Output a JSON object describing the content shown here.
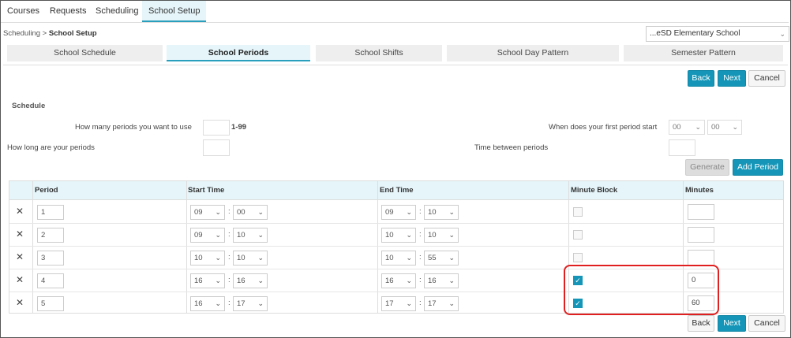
{
  "nav": [
    {
      "label": "Courses"
    },
    {
      "label": "Requests"
    },
    {
      "label": "Scheduling"
    },
    {
      "label": "School Setup",
      "active": true
    }
  ],
  "breadcrumb": {
    "parent": "Scheduling",
    "separator": ">",
    "current": "School Setup"
  },
  "school_select": {
    "value": "...eSD Elementary School"
  },
  "tabs": [
    {
      "label": "School Schedule"
    },
    {
      "label": "School Periods",
      "active": true
    },
    {
      "label": "School Shifts"
    },
    {
      "label": "School Day Pattern"
    },
    {
      "label": "Semester Pattern"
    }
  ],
  "actions": {
    "back": "Back",
    "next": "Next",
    "cancel": "Cancel"
  },
  "schedule": {
    "title": "Schedule",
    "periods_question": "How many periods you want to use",
    "periods_range": "1-99",
    "first_period_question": "When does your first period start",
    "first_hour": "00",
    "first_minute": "00",
    "length_question": "How long are your periods",
    "between_question": "Time between periods",
    "generate": "Generate",
    "add_period": "Add Period"
  },
  "table": {
    "headers": [
      "Period",
      "Start Time",
      "End Time",
      "Minute Block",
      "Minutes"
    ],
    "rows": [
      {
        "period": "1",
        "start_h": "09",
        "start_m": "00",
        "end_h": "09",
        "end_m": "10",
        "minute_block": false,
        "minutes": ""
      },
      {
        "period": "2",
        "start_h": "09",
        "start_m": "10",
        "end_h": "10",
        "end_m": "10",
        "minute_block": false,
        "minutes": ""
      },
      {
        "period": "3",
        "start_h": "10",
        "start_m": "10",
        "end_h": "10",
        "end_m": "55",
        "minute_block": false,
        "minutes": ""
      },
      {
        "period": "4",
        "start_h": "16",
        "start_m": "16",
        "end_h": "16",
        "end_m": "16",
        "minute_block": true,
        "minutes": "0"
      },
      {
        "period": "5",
        "start_h": "16",
        "start_m": "17",
        "end_h": "17",
        "end_m": "17",
        "minute_block": true,
        "minutes": "60"
      }
    ]
  },
  "icons": {
    "delete": "close-icon",
    "dropdown": "chevron-down-icon",
    "check": "check-icon"
  },
  "colors": {
    "accent": "#1596b8",
    "active_tab_bg": "#e5f5fa",
    "highlight": "#e02020"
  }
}
